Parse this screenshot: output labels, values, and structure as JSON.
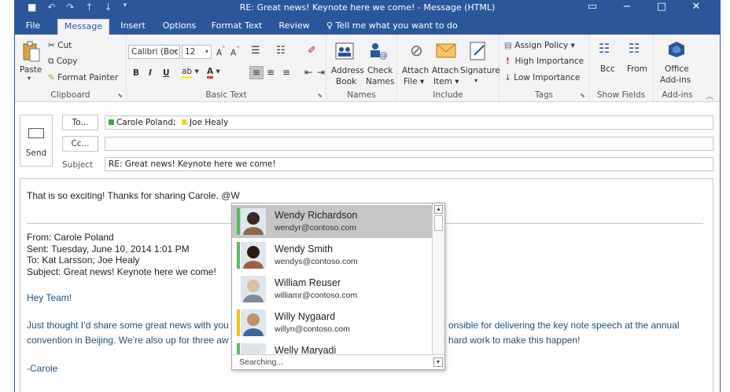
{
  "titlebar": {
    "title": "RE: Great news! Keynote here we come! - Message (HTML)",
    "qat_icons": [
      "save-icon",
      "undo-icon",
      "redo-icon",
      "up-arrow-icon",
      "down-arrow-icon",
      "customize-icon"
    ],
    "minimize": "−",
    "restore": "▭",
    "maximize": "□",
    "close": "✕"
  },
  "tabs": [
    {
      "label": "File"
    },
    {
      "label": "Message"
    },
    {
      "label": "Insert"
    },
    {
      "label": "Options"
    },
    {
      "label": "Format Text"
    },
    {
      "label": "Review"
    }
  ],
  "tellme": "Tell me what you want to do",
  "ribbon": {
    "clipboard": {
      "label": "Clipboard",
      "paste": "Paste",
      "cut": "Cut",
      "copy": "Copy",
      "format_painter": "Format Painter"
    },
    "basic_text": {
      "label": "Basic Text",
      "font": "Calibri (Boc",
      "size": "12",
      "bold": "B",
      "italic": "I",
      "underline": "U"
    },
    "names": {
      "label": "Names",
      "address1": "Address",
      "address2": "Book",
      "check1": "Check",
      "check2": "Names"
    },
    "include": {
      "label": "Include",
      "attach_file1": "Attach",
      "attach_file2": "File",
      "attach_item1": "Attach",
      "attach_item2": "Item",
      "signature": "Signature"
    },
    "tags": {
      "label": "Tags",
      "assign_policy": "Assign Policy",
      "high": "High Importance",
      "low": "Low Importance"
    },
    "show_fields": {
      "label": "Show Fields",
      "bcc": "Bcc",
      "from": "From"
    },
    "addins": {
      "label": "Add-ins",
      "office1": "Office",
      "office2": "Add-ins"
    }
  },
  "header": {
    "send": "Send",
    "to_btn": "To...",
    "cc_btn": "Cc...",
    "subject_label": "Subject",
    "to_recipients": [
      {
        "name": "Carole Poland;",
        "color": "#3aa845"
      },
      {
        "name": "Joe Healy",
        "color": "#e8d83a"
      }
    ],
    "cc_value": "",
    "subject_value": "RE: Great news! Keynote here we come!"
  },
  "body": {
    "reply": "That is so exciting! Thanks for sharing Carole. @W",
    "from": "From: Carole Poland",
    "sent": "Sent: Tuesday, June 10, 2014 1:01 PM",
    "to": "To: Kat Larsson; Joe Healy",
    "subject": "Subject: Great news! Keynote here we come!",
    "greeting": "Hey Team!",
    "para1_left": "Just thought I’d share some great news with you",
    "para1_right": "onsible for delivering the key note speech at the annual",
    "para2_left": "convention in Beijing. We’re also up for three aw",
    "para2_right": "hard work to make this happen!",
    "signoff": "-Carole"
  },
  "autocomplete": {
    "items": [
      {
        "name": "Wendy Richardson",
        "email": "wendyr@contoso.com",
        "presence": "#5cb85c",
        "selected": true
      },
      {
        "name": "Wendy Smith",
        "email": "wendys@contoso.com",
        "presence": "#5cb85c",
        "selected": false
      },
      {
        "name": "William Reuser",
        "email": "williamr@contoso.com",
        "presence": "#ffffff",
        "selected": false
      },
      {
        "name": "Willy Nygaard",
        "email": "willyn@contoso.com",
        "presence": "#f4c20d",
        "selected": false
      },
      {
        "name": "Welly Maryadi",
        "email": "",
        "presence": "#5cb85c",
        "selected": false
      }
    ],
    "status": "Searching..."
  }
}
